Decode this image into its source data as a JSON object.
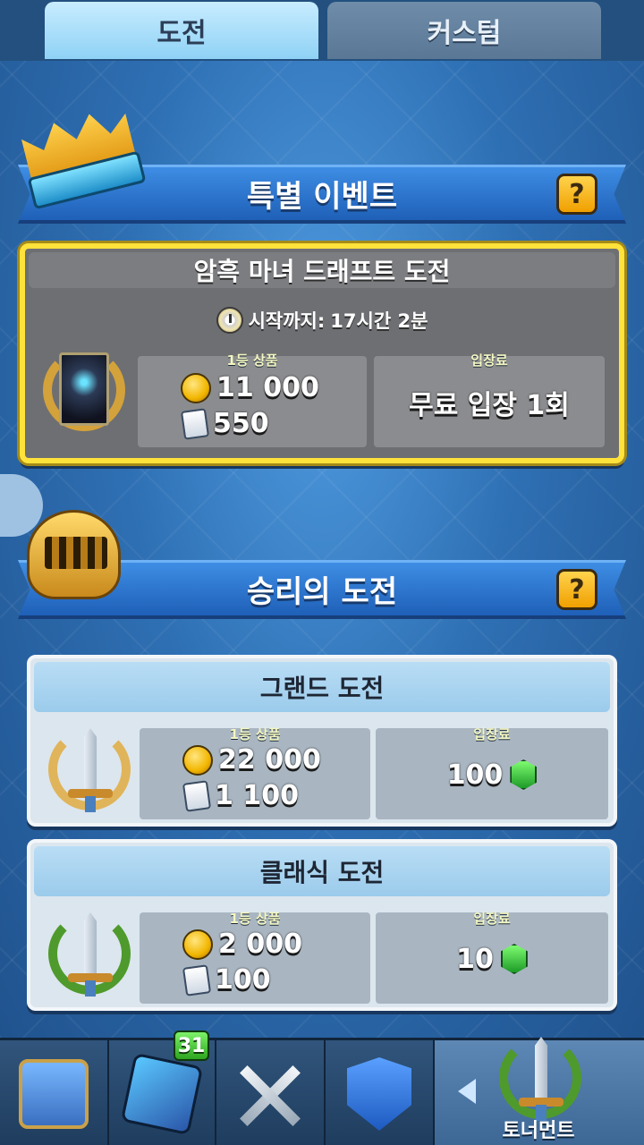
{
  "tabs": [
    {
      "label": "도전",
      "active": true
    },
    {
      "label": "커스텀",
      "active": false
    }
  ],
  "special_event": {
    "header": "특별 이벤트",
    "help_label": "?",
    "card": {
      "title": "암흑 마녀 드래프트 도전",
      "countdown_label": "시작까지:",
      "countdown_value": "17시간 2분",
      "first_prize_label": "1등 상품",
      "gold": "11 000",
      "cards": "550",
      "entry_label": "입장료",
      "entry_value": "무료 입장 1회"
    }
  },
  "victory_challenges": {
    "header": "승리의 도전",
    "help_label": "?",
    "challenges": [
      {
        "title": "그랜드 도전",
        "first_prize_label": "1등 상품",
        "gold": "22 000",
        "cards": "1 100",
        "entry_label": "입장료",
        "entry_cost": "100",
        "entry_icon": "gem-icon"
      },
      {
        "title": "클래식 도전",
        "first_prize_label": "1등 상품",
        "gold": "2 000",
        "cards": "100",
        "entry_label": "입장료",
        "entry_cost": "10",
        "entry_icon": "gem-icon"
      }
    ]
  },
  "bottom_nav": {
    "items": [
      {
        "icon": "shop-chest-icon"
      },
      {
        "icon": "card-deck-icon",
        "badge": "31"
      },
      {
        "icon": "battle-swords-icon"
      },
      {
        "icon": "clan-icon"
      },
      {
        "icon": "tournament-icon",
        "label": "토너먼트",
        "active": true
      }
    ]
  },
  "colors": {
    "accent_yellow": "#ffe23a",
    "ribbon_blue": "#2f78d3",
    "gem_green": "#2fbf3a"
  }
}
